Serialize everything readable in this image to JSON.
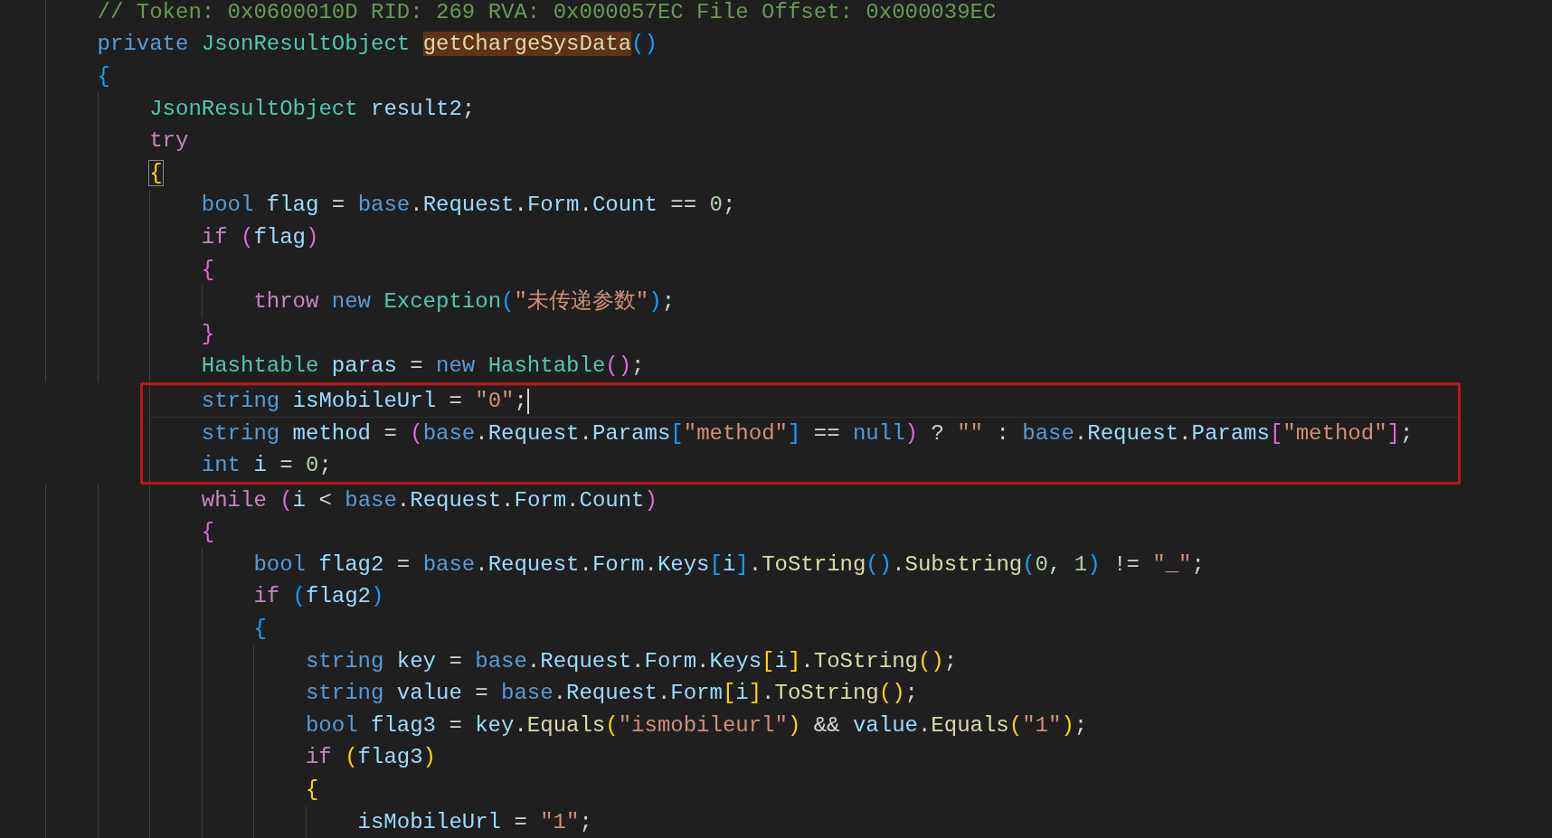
{
  "lines": [
    {
      "tokens": [
        {
          "text": "// Token: 0x0600010D RID: 269 RVA: 0x000057EC File Offset: 0x000039EC",
          "kind": "c"
        }
      ]
    },
    {
      "tokens": [
        {
          "text": "private ",
          "kind": "k"
        },
        {
          "text": "JsonResultObject ",
          "kind": "t"
        },
        {
          "text": "getChargeSysData",
          "kind": "m"
        },
        {
          "text": "()",
          "kind": "b"
        }
      ]
    },
    {
      "tokens": [
        {
          "text": "{",
          "kind": "b"
        }
      ],
      "children": [
        {
          "tokens": [
            {
              "text": "JsonResultObject ",
              "kind": "t"
            },
            {
              "text": "result2",
              "kind": "v"
            },
            {
              "text": ";",
              "kind": "p"
            }
          ]
        },
        {
          "tokens": [
            {
              "text": "try",
              "kind": "x"
            }
          ]
        },
        {
          "tokens": [
            {
              "text": "{",
              "kind": "q"
            }
          ],
          "children": [
            {
              "tokens": [
                {
                  "text": "bool ",
                  "kind": "k"
                },
                {
                  "text": "flag",
                  "kind": "v"
                },
                {
                  "text": " = ",
                  "kind": "p"
                },
                {
                  "text": "base",
                  "kind": "k"
                },
                {
                  "text": ".",
                  "kind": "p"
                },
                {
                  "text": "Request",
                  "kind": "v"
                },
                {
                  "text": ".",
                  "kind": "p"
                },
                {
                  "text": "Form",
                  "kind": "v"
                },
                {
                  "text": ".",
                  "kind": "p"
                },
                {
                  "text": "Count",
                  "kind": "v"
                },
                {
                  "text": " == ",
                  "kind": "p"
                },
                {
                  "text": "0",
                  "kind": "n"
                },
                {
                  "text": ";",
                  "kind": "p"
                }
              ]
            },
            {
              "tokens": [
                {
                  "text": "if ",
                  "kind": "x"
                },
                {
                  "text": "(",
                  "kind": "o"
                },
                {
                  "text": "flag",
                  "kind": "v"
                },
                {
                  "text": ")",
                  "kind": "o"
                }
              ]
            },
            {
              "tokens": [
                {
                  "text": "{",
                  "kind": "o"
                }
              ],
              "children": [
                {
                  "tokens": [
                    {
                      "text": "throw ",
                      "kind": "x"
                    },
                    {
                      "text": "new ",
                      "kind": "k"
                    },
                    {
                      "text": "Exception",
                      "kind": "t"
                    },
                    {
                      "text": "(",
                      "kind": "b"
                    },
                    {
                      "text": "\"未传递参数\"",
                      "kind": "s"
                    },
                    {
                      "text": ")",
                      "kind": "b"
                    },
                    {
                      "text": ";",
                      "kind": "p"
                    }
                  ]
                }
              ]
            },
            {
              "tokens": [
                {
                  "text": "}",
                  "kind": "o"
                }
              ]
            },
            {
              "tokens": [
                {
                  "text": "Hashtable ",
                  "kind": "t"
                },
                {
                  "text": "paras",
                  "kind": "v"
                },
                {
                  "text": " = ",
                  "kind": "p"
                },
                {
                  "text": "new ",
                  "kind": "k"
                },
                {
                  "text": "Hashtable",
                  "kind": "t"
                },
                {
                  "text": "()",
                  "kind": "o"
                },
                {
                  "text": ";",
                  "kind": "p"
                }
              ]
            },
            {
              "tokens": [
                {
                  "text": "string ",
                  "kind": "k"
                },
                {
                  "text": "isMobileUrl",
                  "kind": "v"
                },
                {
                  "text": " = ",
                  "kind": "p"
                },
                {
                  "text": "\"0\"",
                  "kind": "s"
                },
                {
                  "text": ";",
                  "kind": "p"
                }
              ],
              "boxed": true,
              "cursor": true
            },
            {
              "tokens": [
                {
                  "text": "string ",
                  "kind": "k"
                },
                {
                  "text": "method",
                  "kind": "v"
                },
                {
                  "text": " = ",
                  "kind": "p"
                },
                {
                  "text": "(",
                  "kind": "o"
                },
                {
                  "text": "base",
                  "kind": "k"
                },
                {
                  "text": ".",
                  "kind": "p"
                },
                {
                  "text": "Request",
                  "kind": "v"
                },
                {
                  "text": ".",
                  "kind": "p"
                },
                {
                  "text": "Params",
                  "kind": "v"
                },
                {
                  "text": "[",
                  "kind": "b"
                },
                {
                  "text": "\"method\"",
                  "kind": "s"
                },
                {
                  "text": "]",
                  "kind": "b"
                },
                {
                  "text": " == ",
                  "kind": "p"
                },
                {
                  "text": "null",
                  "kind": "k"
                },
                {
                  "text": ")",
                  "kind": "o"
                },
                {
                  "text": " ? ",
                  "kind": "p"
                },
                {
                  "text": "\"\"",
                  "kind": "s"
                },
                {
                  "text": " : ",
                  "kind": "p"
                },
                {
                  "text": "base",
                  "kind": "k"
                },
                {
                  "text": ".",
                  "kind": "p"
                },
                {
                  "text": "Request",
                  "kind": "v"
                },
                {
                  "text": ".",
                  "kind": "p"
                },
                {
                  "text": "Params",
                  "kind": "v"
                },
                {
                  "text": "[",
                  "kind": "o"
                },
                {
                  "text": "\"method\"",
                  "kind": "s"
                },
                {
                  "text": "]",
                  "kind": "o"
                },
                {
                  "text": ";",
                  "kind": "p"
                }
              ],
              "boxed": true
            },
            {
              "tokens": [
                {
                  "text": "int ",
                  "kind": "k"
                },
                {
                  "text": "i",
                  "kind": "v"
                },
                {
                  "text": " = ",
                  "kind": "p"
                },
                {
                  "text": "0",
                  "kind": "n"
                },
                {
                  "text": ";",
                  "kind": "p"
                }
              ],
              "boxed": true
            },
            {
              "tokens": [
                {
                  "text": "while ",
                  "kind": "x"
                },
                {
                  "text": "(",
                  "kind": "o"
                },
                {
                  "text": "i",
                  "kind": "v"
                },
                {
                  "text": " < ",
                  "kind": "p"
                },
                {
                  "text": "base",
                  "kind": "k"
                },
                {
                  "text": ".",
                  "kind": "p"
                },
                {
                  "text": "Request",
                  "kind": "v"
                },
                {
                  "text": ".",
                  "kind": "p"
                },
                {
                  "text": "Form",
                  "kind": "v"
                },
                {
                  "text": ".",
                  "kind": "p"
                },
                {
                  "text": "Count",
                  "kind": "v"
                },
                {
                  "text": ")",
                  "kind": "o"
                }
              ]
            },
            {
              "tokens": [
                {
                  "text": "{",
                  "kind": "o"
                }
              ],
              "children": [
                {
                  "tokens": [
                    {
                      "text": "bool ",
                      "kind": "k"
                    },
                    {
                      "text": "flag2",
                      "kind": "v"
                    },
                    {
                      "text": " = ",
                      "kind": "p"
                    },
                    {
                      "text": "base",
                      "kind": "k"
                    },
                    {
                      "text": ".",
                      "kind": "p"
                    },
                    {
                      "text": "Request",
                      "kind": "v"
                    },
                    {
                      "text": ".",
                      "kind": "p"
                    },
                    {
                      "text": "Form",
                      "kind": "v"
                    },
                    {
                      "text": ".",
                      "kind": "p"
                    },
                    {
                      "text": "Keys",
                      "kind": "v"
                    },
                    {
                      "text": "[",
                      "kind": "b"
                    },
                    {
                      "text": "i",
                      "kind": "v"
                    },
                    {
                      "text": "]",
                      "kind": "b"
                    },
                    {
                      "text": ".",
                      "kind": "p"
                    },
                    {
                      "text": "ToString",
                      "kind": "f"
                    },
                    {
                      "text": "()",
                      "kind": "b"
                    },
                    {
                      "text": ".",
                      "kind": "p"
                    },
                    {
                      "text": "Substring",
                      "kind": "f"
                    },
                    {
                      "text": "(",
                      "kind": "b"
                    },
                    {
                      "text": "0",
                      "kind": "n"
                    },
                    {
                      "text": ", ",
                      "kind": "p"
                    },
                    {
                      "text": "1",
                      "kind": "n"
                    },
                    {
                      "text": ")",
                      "kind": "b"
                    },
                    {
                      "text": " != ",
                      "kind": "p"
                    },
                    {
                      "text": "\"_\"",
                      "kind": "s"
                    },
                    {
                      "text": ";",
                      "kind": "p"
                    }
                  ]
                },
                {
                  "tokens": [
                    {
                      "text": "if ",
                      "kind": "x"
                    },
                    {
                      "text": "(",
                      "kind": "b"
                    },
                    {
                      "text": "flag2",
                      "kind": "v"
                    },
                    {
                      "text": ")",
                      "kind": "b"
                    }
                  ]
                },
                {
                  "tokens": [
                    {
                      "text": "{",
                      "kind": "b"
                    }
                  ],
                  "children": [
                    {
                      "tokens": [
                        {
                          "text": "string ",
                          "kind": "k"
                        },
                        {
                          "text": "key",
                          "kind": "v"
                        },
                        {
                          "text": " = ",
                          "kind": "p"
                        },
                        {
                          "text": "base",
                          "kind": "k"
                        },
                        {
                          "text": ".",
                          "kind": "p"
                        },
                        {
                          "text": "Request",
                          "kind": "v"
                        },
                        {
                          "text": ".",
                          "kind": "p"
                        },
                        {
                          "text": "Form",
                          "kind": "v"
                        },
                        {
                          "text": ".",
                          "kind": "p"
                        },
                        {
                          "text": "Keys",
                          "kind": "v"
                        },
                        {
                          "text": "[",
                          "kind": "g"
                        },
                        {
                          "text": "i",
                          "kind": "v"
                        },
                        {
                          "text": "]",
                          "kind": "g"
                        },
                        {
                          "text": ".",
                          "kind": "p"
                        },
                        {
                          "text": "ToString",
                          "kind": "f"
                        },
                        {
                          "text": "()",
                          "kind": "g"
                        },
                        {
                          "text": ";",
                          "kind": "p"
                        }
                      ]
                    },
                    {
                      "tokens": [
                        {
                          "text": "string ",
                          "kind": "k"
                        },
                        {
                          "text": "value",
                          "kind": "v"
                        },
                        {
                          "text": " = ",
                          "kind": "p"
                        },
                        {
                          "text": "base",
                          "kind": "k"
                        },
                        {
                          "text": ".",
                          "kind": "p"
                        },
                        {
                          "text": "Request",
                          "kind": "v"
                        },
                        {
                          "text": ".",
                          "kind": "p"
                        },
                        {
                          "text": "Form",
                          "kind": "v"
                        },
                        {
                          "text": "[",
                          "kind": "g"
                        },
                        {
                          "text": "i",
                          "kind": "v"
                        },
                        {
                          "text": "]",
                          "kind": "g"
                        },
                        {
                          "text": ".",
                          "kind": "p"
                        },
                        {
                          "text": "ToString",
                          "kind": "f"
                        },
                        {
                          "text": "()",
                          "kind": "g"
                        },
                        {
                          "text": ";",
                          "kind": "p"
                        }
                      ]
                    },
                    {
                      "tokens": [
                        {
                          "text": "bool ",
                          "kind": "k"
                        },
                        {
                          "text": "flag3",
                          "kind": "v"
                        },
                        {
                          "text": " = ",
                          "kind": "p"
                        },
                        {
                          "text": "key",
                          "kind": "v"
                        },
                        {
                          "text": ".",
                          "kind": "p"
                        },
                        {
                          "text": "Equals",
                          "kind": "f"
                        },
                        {
                          "text": "(",
                          "kind": "g"
                        },
                        {
                          "text": "\"ismobileurl\"",
                          "kind": "s"
                        },
                        {
                          "text": ")",
                          "kind": "g"
                        },
                        {
                          "text": " && ",
                          "kind": "p"
                        },
                        {
                          "text": "value",
                          "kind": "v"
                        },
                        {
                          "text": ".",
                          "kind": "p"
                        },
                        {
                          "text": "Equals",
                          "kind": "f"
                        },
                        {
                          "text": "(",
                          "kind": "g"
                        },
                        {
                          "text": "\"1\"",
                          "kind": "s"
                        },
                        {
                          "text": ")",
                          "kind": "g"
                        },
                        {
                          "text": ";",
                          "kind": "p"
                        }
                      ]
                    },
                    {
                      "tokens": [
                        {
                          "text": "if ",
                          "kind": "x"
                        },
                        {
                          "text": "(",
                          "kind": "g"
                        },
                        {
                          "text": "flag3",
                          "kind": "v"
                        },
                        {
                          "text": ")",
                          "kind": "g"
                        }
                      ]
                    },
                    {
                      "tokens": [
                        {
                          "text": "{",
                          "kind": "g"
                        }
                      ],
                      "children": [
                        {
                          "tokens": [
                            {
                              "text": "isMobileUrl",
                              "kind": "v"
                            },
                            {
                              "text": " = ",
                              "kind": "p"
                            },
                            {
                              "text": "\"1\"",
                              "kind": "s"
                            },
                            {
                              "text": ";",
                              "kind": "p"
                            }
                          ]
                        }
                      ]
                    }
                  ]
                }
              ]
            }
          ]
        }
      ]
    }
  ]
}
